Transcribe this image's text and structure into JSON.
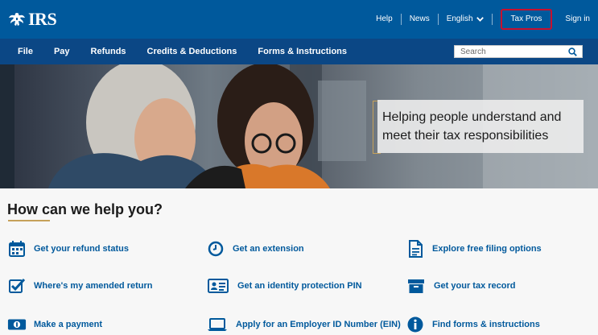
{
  "header": {
    "logo_text": "IRS",
    "utility_nav": [
      {
        "label": "Help"
      },
      {
        "label": "News"
      },
      {
        "label": "English"
      },
      {
        "label": "Tax Pros"
      },
      {
        "label": "Sign in"
      }
    ]
  },
  "main_nav": {
    "items": [
      {
        "label": "File"
      },
      {
        "label": "Pay"
      },
      {
        "label": "Refunds"
      },
      {
        "label": "Credits & Deductions"
      },
      {
        "label": "Forms & Instructions"
      }
    ],
    "search_placeholder": "Search"
  },
  "hero": {
    "callout_text": "Helping people understand and meet their tax responsibilities"
  },
  "help": {
    "title": "How can we help you?",
    "links": [
      {
        "label": "Get your refund status",
        "icon": "calendar-icon"
      },
      {
        "label": "Get an extension",
        "icon": "clock-icon"
      },
      {
        "label": "Explore free filing options",
        "icon": "document-icon"
      },
      {
        "label": "Where's my amended return",
        "icon": "checkbox-icon"
      },
      {
        "label": "Get an identity protection PIN",
        "icon": "id-card-icon"
      },
      {
        "label": "Get your tax record",
        "icon": "archive-box-icon"
      },
      {
        "label": "Make a payment",
        "icon": "money-icon"
      },
      {
        "label": "Apply for an Employer ID Number (EIN)",
        "icon": "laptop-icon"
      },
      {
        "label": "Find forms & instructions",
        "icon": "info-icon"
      }
    ]
  },
  "colors": {
    "header_blue": "#00599c",
    "nav_blue": "#0b4785",
    "link_blue": "#00599c",
    "accent_gold": "#c6a15a",
    "tax_pros_outline": "#c8102e"
  }
}
